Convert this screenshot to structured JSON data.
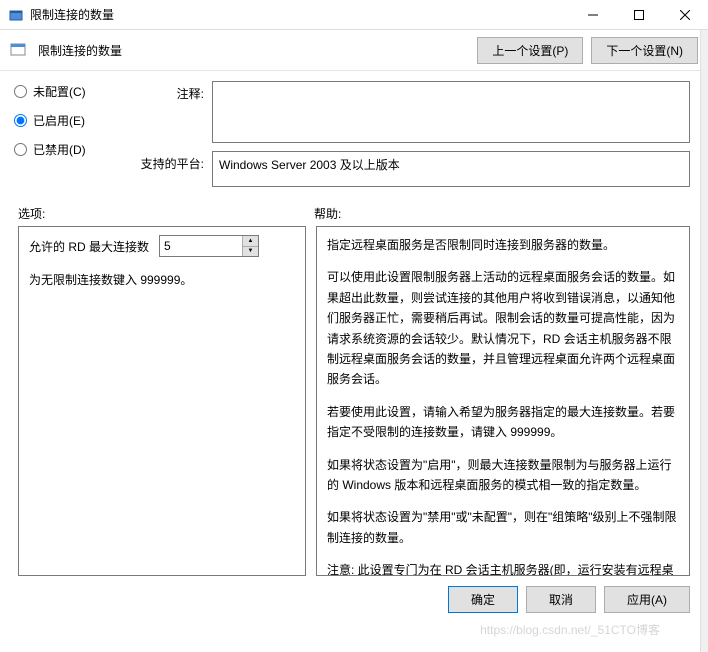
{
  "window": {
    "title": "限制连接的数量"
  },
  "header": {
    "title": "限制连接的数量",
    "prev": "上一个设置(P)",
    "next": "下一个设置(N)"
  },
  "radios": {
    "not_configured": "未配置(C)",
    "enabled": "已启用(E)",
    "disabled": "已禁用(D)",
    "selected": "enabled"
  },
  "fields": {
    "comment_label": "注释:",
    "comment_value": "",
    "platform_label": "支持的平台:",
    "platform_value": "Windows Server 2003 及以上版本"
  },
  "section_labels": {
    "options": "选项:",
    "help": "帮助:"
  },
  "options": {
    "max_conn_label": "允许的 RD 最大连接数",
    "max_conn_value": "5",
    "unlimited_hint": "为无限制连接数键入 999999。"
  },
  "help": {
    "p1": "指定远程桌面服务是否限制同时连接到服务器的数量。",
    "p2": "可以使用此设置限制服务器上活动的远程桌面服务会话的数量。如果超出此数量，则尝试连接的其他用户将收到错误消息，以通知他们服务器正忙，需要稍后再试。限制会话的数量可提高性能，因为请求系统资源的会话较少。默认情况下，RD 会话主机服务器不限制远程桌面服务会话的数量，并且管理远程桌面允许两个远程桌面服务会话。",
    "p3": "若要使用此设置，请输入希望为服务器指定的最大连接数量。若要指定不受限制的连接数量，请键入 999999。",
    "p4": "如果将状态设置为\"启用\"，则最大连接数量限制为与服务器上运行的 Windows 版本和远程桌面服务的模式相一致的指定数量。",
    "p5": "如果将状态设置为\"禁用\"或\"未配置\"，则在\"组策略\"级别上不强制限制连接的数量。",
    "p6": "注意: 此设置专门为在 RD 会话主机服务器(即，运行安装有远程桌面会话主机角色服务的 Windows 的服务器)上使用而设计。"
  },
  "footer": {
    "ok": "确定",
    "cancel": "取消",
    "apply": "应用(A)"
  },
  "watermark": "https://blog.csdn.net/_51CTO博客"
}
